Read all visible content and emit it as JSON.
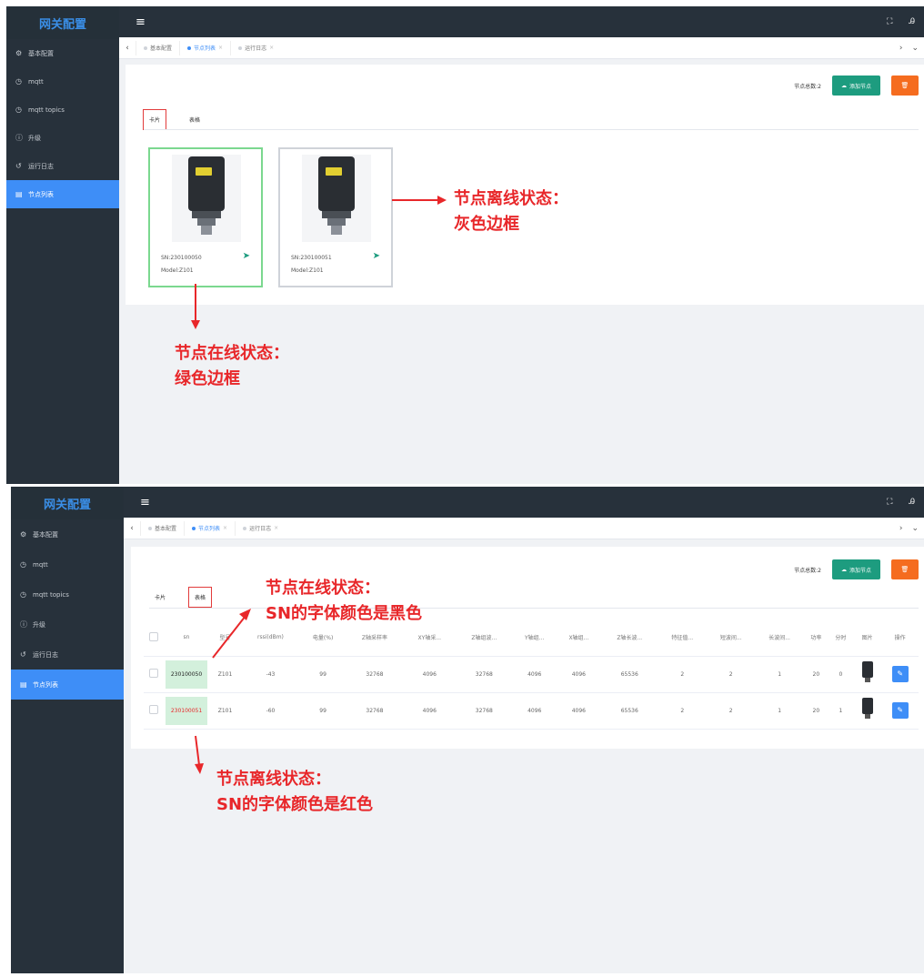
{
  "app": {
    "brand": "网关配置"
  },
  "sidebar": {
    "items": [
      {
        "label": "基本配置",
        "icon": "gear-icon"
      },
      {
        "label": "mqtt",
        "icon": "clock-icon"
      },
      {
        "label": "mqtt topics",
        "icon": "clock-icon"
      },
      {
        "label": "升级",
        "icon": "info-icon"
      },
      {
        "label": "运行日志",
        "icon": "history-icon"
      },
      {
        "label": "节点列表",
        "icon": "list-icon",
        "active": true
      }
    ]
  },
  "tabs": [
    {
      "label": "基本配置"
    },
    {
      "label": "节点列表",
      "active": true
    },
    {
      "label": "运行日志"
    }
  ],
  "panel": {
    "count_label": "节点总数:2",
    "add_button": "添加节点",
    "subtabs": [
      "卡片",
      "表格"
    ]
  },
  "cards": [
    {
      "sn": "SN:230100050",
      "model": "Model:Z101",
      "status": "online",
      "border_color": "#7bd88f"
    },
    {
      "sn": "SN:230100051",
      "model": "Model:Z101",
      "status": "offline",
      "border_color": "#cfd3d9"
    }
  ],
  "table": {
    "headers": [
      "sn",
      "型号",
      "rssi(dBm)",
      "电量(%)",
      "Z轴采样率",
      "XY轴采...",
      "Z轴组波...",
      "Y轴组...",
      "X轴组...",
      "Z轴长波...",
      "特征值...",
      "短波间...",
      "长波间...",
      "功率",
      "分时",
      "图片",
      "操作"
    ],
    "rows": [
      {
        "sn": "230100050",
        "sn_color": "#222222",
        "cells": [
          "Z101",
          "-43",
          "99",
          "32768",
          "4096",
          "32768",
          "4096",
          "4096",
          "65536",
          "2",
          "2",
          "1",
          "20",
          "0"
        ]
      },
      {
        "sn": "230100051",
        "sn_color": "#e8272a",
        "cells": [
          "Z101",
          "-60",
          "99",
          "32768",
          "4096",
          "32768",
          "4096",
          "4096",
          "65536",
          "2",
          "2",
          "1",
          "20",
          "1"
        ]
      }
    ]
  },
  "annotations": {
    "offline_card": [
      "节点离线状态：",
      "灰色边框"
    ],
    "online_card": [
      "节点在线状态：",
      "绿色边框"
    ],
    "online_table": [
      "节点在线状态：",
      "SN的字体颜色是黑色"
    ],
    "offline_table": [
      "节点离线状态：",
      "SN的字体颜色是红色"
    ]
  },
  "colors": {
    "annotation": "#e8272a",
    "accent": "#3e8ef7",
    "add_button": "#1d9c7f",
    "delete_button": "#f56c1f"
  }
}
